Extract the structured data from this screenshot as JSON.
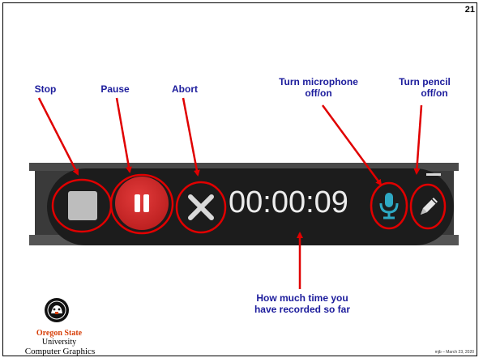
{
  "slide": {
    "number": "21",
    "footer": "mjb – March 23, 2020"
  },
  "annotations": {
    "stop": "Stop",
    "pause": "Pause",
    "abort": "Abort",
    "mic_line1": "Turn microphone",
    "mic_line2": "off/on",
    "pencil_line1": "Turn pencil",
    "pencil_line2": "off/on",
    "time_line1": "How much time you",
    "time_line2": "have recorded so far"
  },
  "recorder": {
    "timer": "00:00:09",
    "stop_icon": "stop-square-icon",
    "pause_icon": "pause-icon",
    "abort_icon": "close-x-icon",
    "mic_icon": "microphone-icon",
    "pencil_icon": "pencil-icon",
    "minimize_icon": "minimize-icon"
  },
  "logo": {
    "name": "Oregon State",
    "university": "University",
    "department": "Computer Graphics"
  },
  "colors": {
    "annotation_text": "#1c1c9c",
    "callout": "#e00000",
    "pause_red": "#c92222",
    "mic_teal": "#2ea9c4",
    "osu_orange": "#d73f09"
  }
}
